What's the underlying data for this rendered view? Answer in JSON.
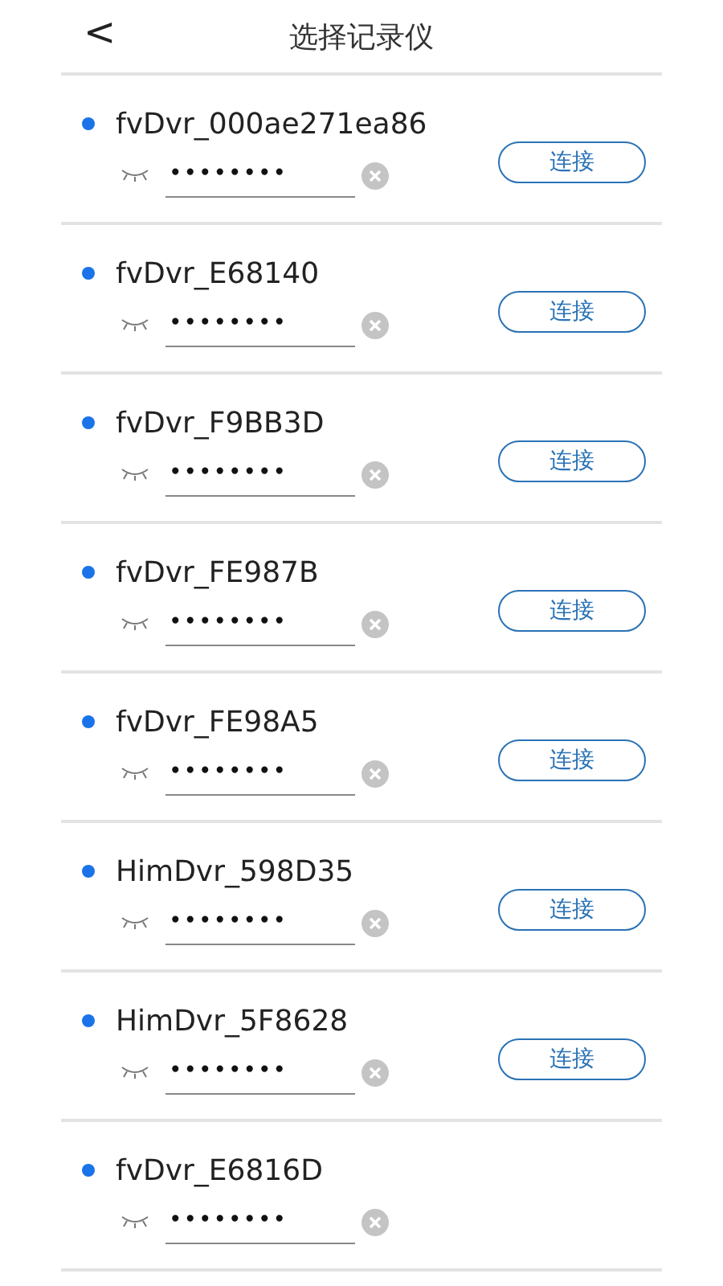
{
  "header": {
    "back": "<",
    "title": "选择记录仪"
  },
  "devices": [
    {
      "name": "fvDvr_000ae271ea86",
      "password": "••••••••",
      "connect": "连接"
    },
    {
      "name": "fvDvr_E68140",
      "password": "••••••••",
      "connect": "连接"
    },
    {
      "name": "fvDvr_F9BB3D",
      "password": "••••••••",
      "connect": "连接"
    },
    {
      "name": "fvDvr_FE987B",
      "password": "••••••••",
      "connect": "连接"
    },
    {
      "name": "fvDvr_FE98A5",
      "password": "••••••••",
      "connect": "连接"
    },
    {
      "name": "HimDvr_598D35",
      "password": "••••••••",
      "connect": "连接"
    },
    {
      "name": "HimDvr_5F8628",
      "password": "••••••••",
      "connect": "连接"
    },
    {
      "name": "fvDvr_E6816D",
      "password": "••••••••"
    }
  ]
}
